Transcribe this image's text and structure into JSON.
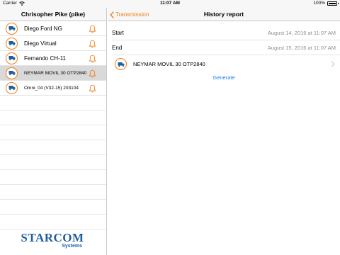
{
  "status_bar": {
    "carrier": "Carrier",
    "time": "11:07 AM",
    "battery_percent": "100%",
    "battery_level": 1.0
  },
  "sidebar": {
    "title": "Chrisopher Pike (pike)",
    "units": [
      {
        "label": "Diego Ford NG",
        "size": "normal",
        "selected": false
      },
      {
        "label": "Diego Virtual",
        "size": "normal",
        "selected": false
      },
      {
        "label": "Fernando CH-11",
        "size": "normal",
        "selected": false
      },
      {
        "label": "NEYMAR MOVIL 30 OTP2840",
        "size": "small",
        "selected": true
      },
      {
        "label": "Omni_04 (V32-15) 203104",
        "size": "small",
        "selected": false
      }
    ],
    "logo": {
      "main": "STARCOM",
      "sub": "Systems"
    }
  },
  "detail": {
    "back_label": "Transmission",
    "title": "History report",
    "start_label": "Start",
    "start_value": "August 14, 2016 at 11:07 AM",
    "end_label": "End",
    "end_value": "August 15, 2016 at 11:07 AM",
    "selected_unit": "NEYMAR MOVIL 30 OTP2840",
    "generate_label": "Generate"
  },
  "colors": {
    "accent": "#f07e1a",
    "link": "#1a7cf5",
    "logo": "#1f5e9c",
    "selected_row": "#d9d9d9"
  },
  "icons": {
    "unit": "truck-icon",
    "alert": "bell-icon",
    "back": "chevron-left-icon",
    "disclosure": "chevron-right-icon",
    "wifi": "wifi-icon",
    "battery": "battery-icon"
  }
}
